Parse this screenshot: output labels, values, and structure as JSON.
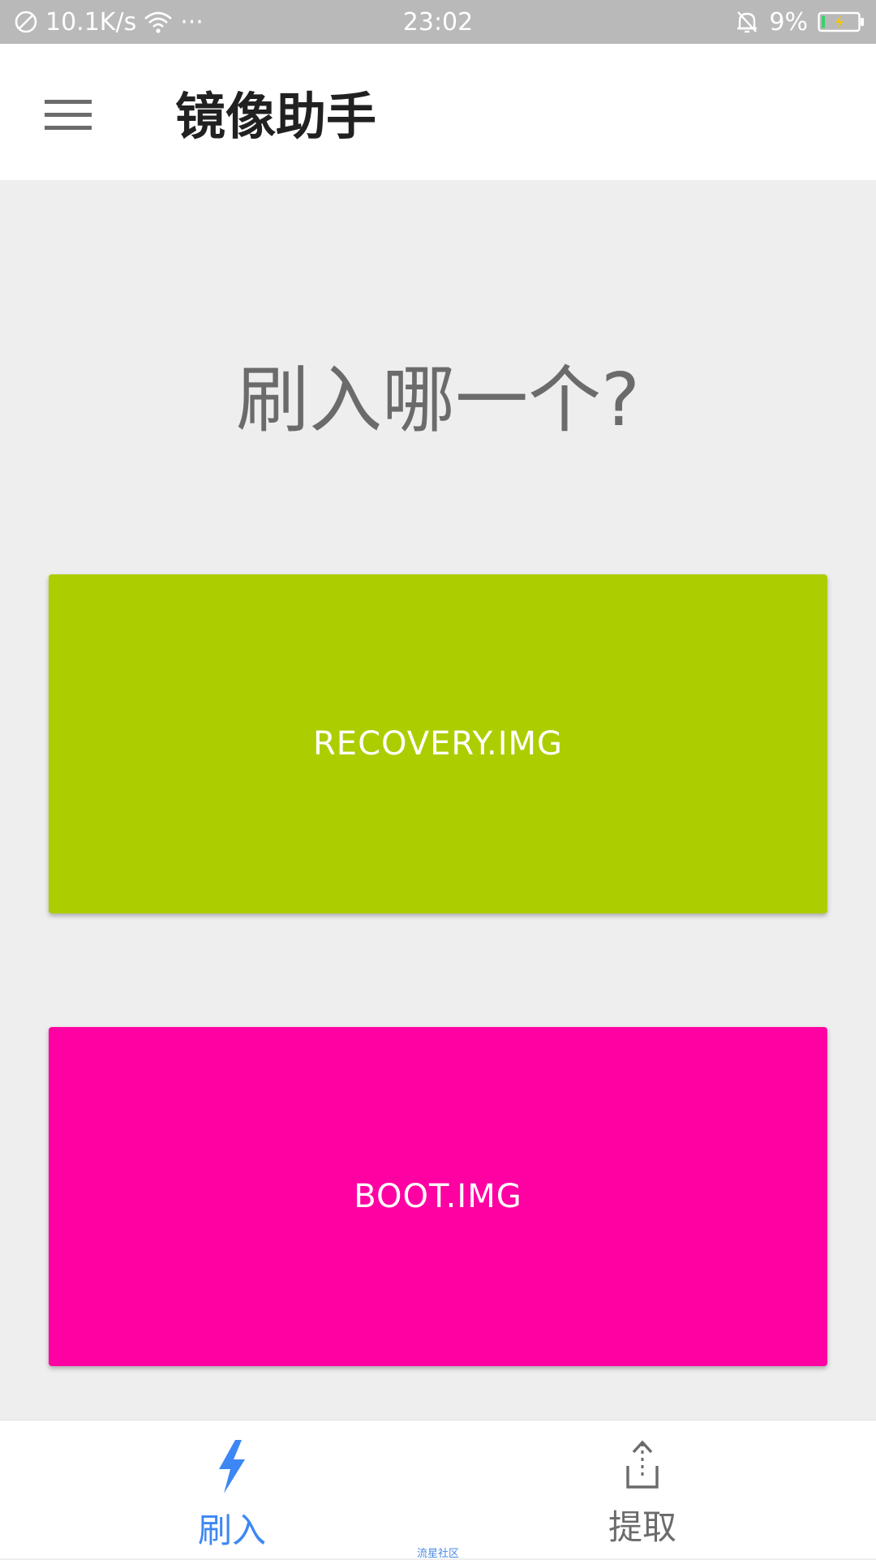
{
  "status_bar": {
    "network_speed": "10.1K/s",
    "more": "···",
    "time": "23:02",
    "battery_percent": "9%"
  },
  "app_bar": {
    "title": "镜像助手",
    "menu_icon": "menu-icon"
  },
  "main": {
    "question": "刷入哪一个?",
    "options": [
      {
        "label": "RECOVERY.IMG",
        "color": "#acce00"
      },
      {
        "label": "BOOT.IMG",
        "color": "#ff00a2"
      }
    ]
  },
  "bottom_nav": {
    "items": [
      {
        "label": "刷入",
        "icon": "flash-icon",
        "active": true,
        "color": "#3d87f5"
      },
      {
        "label": "提取",
        "icon": "upload-icon",
        "active": false,
        "color": "#6b6b6b"
      }
    ]
  },
  "watermark": "流星社区"
}
